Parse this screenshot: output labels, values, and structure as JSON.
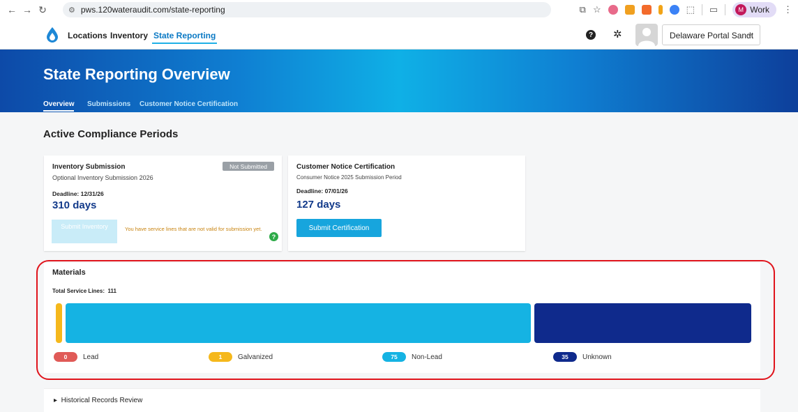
{
  "browser": {
    "url": "pws.120wateraudit.com/state-reporting",
    "profile_initial": "M",
    "profile_label": "Work"
  },
  "nav": {
    "links": [
      "Locations",
      "Inventory",
      "State Reporting"
    ],
    "portal_select": "Delaware Portal Sandt"
  },
  "banner": {
    "title": "State Reporting Overview",
    "tabs": [
      "Overview",
      "Submissions",
      "Customer Notice Certification"
    ]
  },
  "section_title": "Active Compliance Periods",
  "cards": {
    "inventory": {
      "title": "Inventory Submission",
      "badge": "Not Submitted",
      "subtitle": "Optional Inventory Submission 2026",
      "deadline": "Deadline: 12/31/26",
      "days": "310 days",
      "button": "Submit Inventory",
      "warning": "You have service lines that are not valid for submission yet."
    },
    "notice": {
      "title": "Customer Notice Certification",
      "subtitle": "Consumer Notice 2025 Submission Period",
      "deadline": "Deadline: 07/01/26",
      "days": "127 days",
      "button": "Submit Certification"
    }
  },
  "materials": {
    "title": "Materials",
    "total_label": "Total Service Lines:",
    "total_value": "111",
    "items": [
      {
        "label": "Lead",
        "count": "0",
        "value": 0,
        "color": "#e05a57"
      },
      {
        "label": "Galvanized",
        "count": "1",
        "value": 1,
        "color": "#f5b81c"
      },
      {
        "label": "Non-Lead",
        "count": "75",
        "value": 75,
        "color": "#15b3e3"
      },
      {
        "label": "Unknown",
        "count": "35",
        "value": 35,
        "color": "#0f2a8c"
      }
    ]
  },
  "historical": {
    "label": "Historical Records Review"
  }
}
